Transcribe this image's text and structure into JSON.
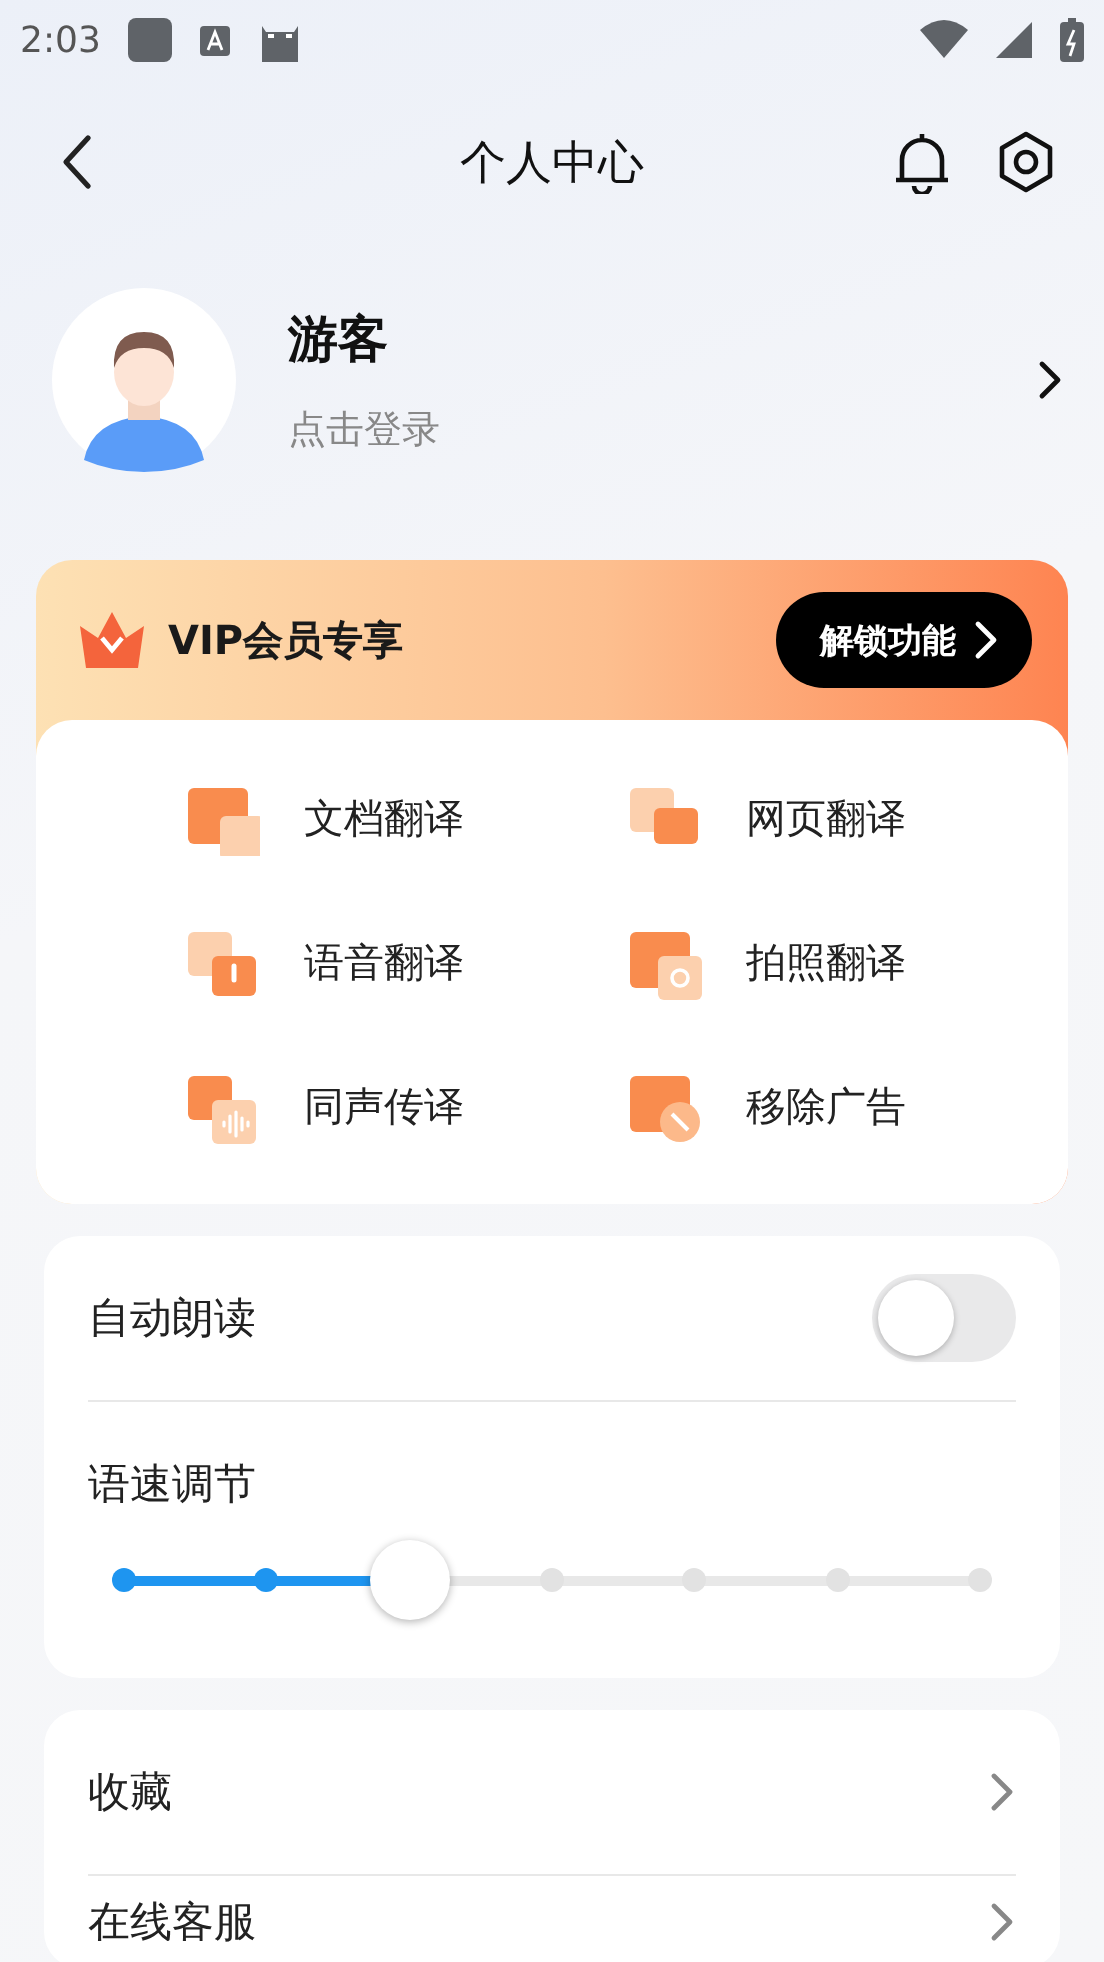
{
  "status_bar": {
    "time": "2:03"
  },
  "header": {
    "title": "个人中心"
  },
  "profile": {
    "name": "游客",
    "subtitle": "点击登录"
  },
  "vip": {
    "title": "VIP会员专享",
    "button": "解锁功能"
  },
  "features": [
    {
      "label": "文档翻译",
      "kind": "doc"
    },
    {
      "label": "网页翻译",
      "kind": "web"
    },
    {
      "label": "语音翻译",
      "kind": "voice"
    },
    {
      "label": "拍照翻译",
      "kind": "photo"
    },
    {
      "label": "同声传译",
      "kind": "simul"
    },
    {
      "label": "移除广告",
      "kind": "noads"
    }
  ],
  "settings": {
    "auto_read": {
      "label": "自动朗读",
      "on": false
    },
    "speed": {
      "label": "语速调节",
      "level": 0.3333
    }
  },
  "menu": [
    {
      "label": "收藏"
    },
    {
      "label": "在线客服"
    }
  ]
}
